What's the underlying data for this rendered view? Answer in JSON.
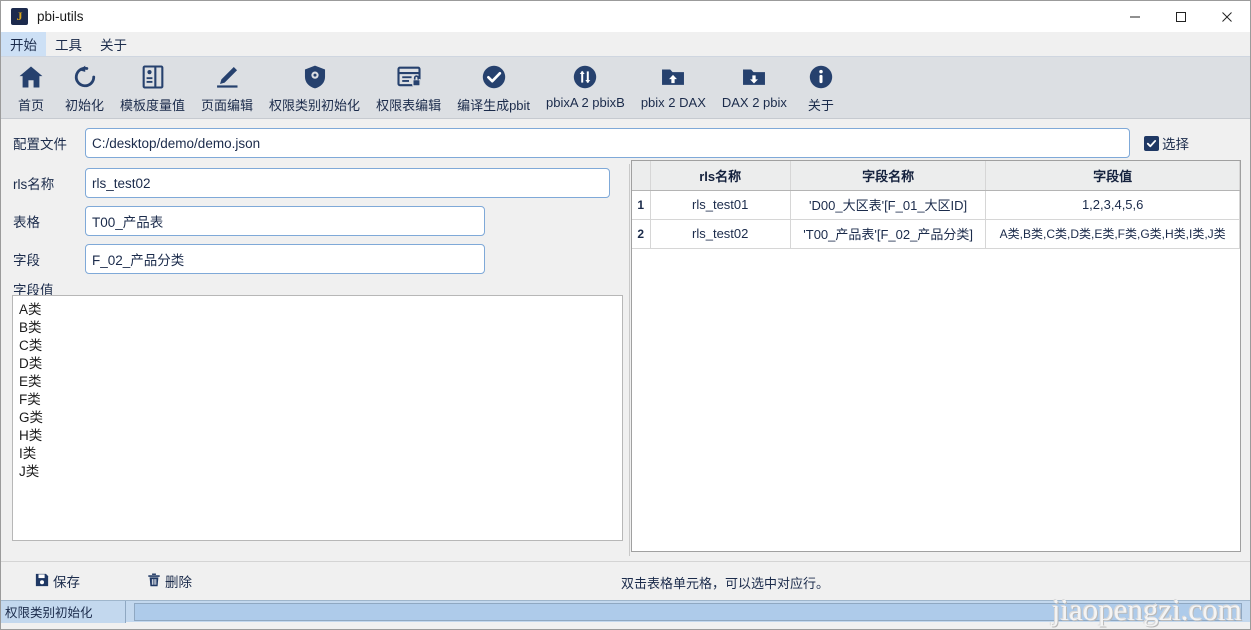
{
  "window": {
    "title": "pbi-utils",
    "icon_letter": "J",
    "icon_name": "app-icon",
    "controls": [
      {
        "name": "minimize-button",
        "glyph": "minimize"
      },
      {
        "name": "maximize-button",
        "glyph": "maximize"
      },
      {
        "name": "close-button",
        "glyph": "close"
      }
    ]
  },
  "menubar": {
    "items": [
      {
        "label": "开始",
        "active": true
      },
      {
        "label": "工具",
        "active": false
      },
      {
        "label": "关于",
        "active": false
      }
    ]
  },
  "toolbar": {
    "items": [
      {
        "label": "首页",
        "icon": "home-icon"
      },
      {
        "label": "初始化",
        "icon": "refresh-icon"
      },
      {
        "label": "模板度量值",
        "icon": "template-measure-icon"
      },
      {
        "label": "页面编辑",
        "icon": "pencil-edit-icon"
      },
      {
        "label": "权限类别初始化",
        "icon": "shield-gear-icon"
      },
      {
        "label": "权限表编辑",
        "icon": "table-lock-icon"
      },
      {
        "label": "编译生成pbit",
        "icon": "check-circle-icon"
      },
      {
        "label": "pbixA 2 pbixB",
        "icon": "swap-circle-icon"
      },
      {
        "label": "pbix 2 DAX",
        "icon": "folder-up-icon"
      },
      {
        "label": "DAX 2 pbix",
        "icon": "folder-down-icon"
      },
      {
        "label": "关于",
        "icon": "info-circle-icon"
      }
    ]
  },
  "form": {
    "config_label": "配置文件",
    "config_value": "C:/desktop/demo/demo.json",
    "config_placeholder": "",
    "select_checkbox_label": "选择",
    "select_checkbox_checked": true,
    "rls_label": "rls名称",
    "rls_value": "rls_test02",
    "table_label": "表格",
    "table_value": "T00_产品表",
    "field_label": "字段",
    "field_value": "F_02_产品分类",
    "values_label": "字段值",
    "values_text": [
      "A类",
      "B类",
      "C类",
      "D类",
      "E类",
      "F类",
      "G类",
      "H类",
      "I类",
      "J类"
    ]
  },
  "grid": {
    "headers": [
      "rls名称",
      "字段名称",
      "字段值"
    ],
    "rows": [
      {
        "num": "1",
        "rls": "rls_test01",
        "field": "'D00_大区表'[F_01_大区ID]",
        "values": "1,2,3,4,5,6"
      },
      {
        "num": "2",
        "rls": "rls_test02",
        "field": "'T00_产品表'[F_02_产品分类]",
        "values": "A类,B类,C类,D类,E类,F类,G类,H类,I类,J类"
      }
    ]
  },
  "bottom": {
    "save_label": "保存",
    "delete_label": "删除",
    "hint": "双击表格单元格，可以选中对应行。"
  },
  "statusbar": {
    "text": "权限类别初始化",
    "progress_percent": 0
  },
  "watermark": "jiaopengzi.com",
  "colors": {
    "accent": "#1f3864",
    "icon_navy": "#26416e",
    "toolbar_bg": "#dcdfe3",
    "status_bg": "#c3d8ee",
    "menu_active": "#cde0f5",
    "input_border": "#7fa9d8"
  }
}
